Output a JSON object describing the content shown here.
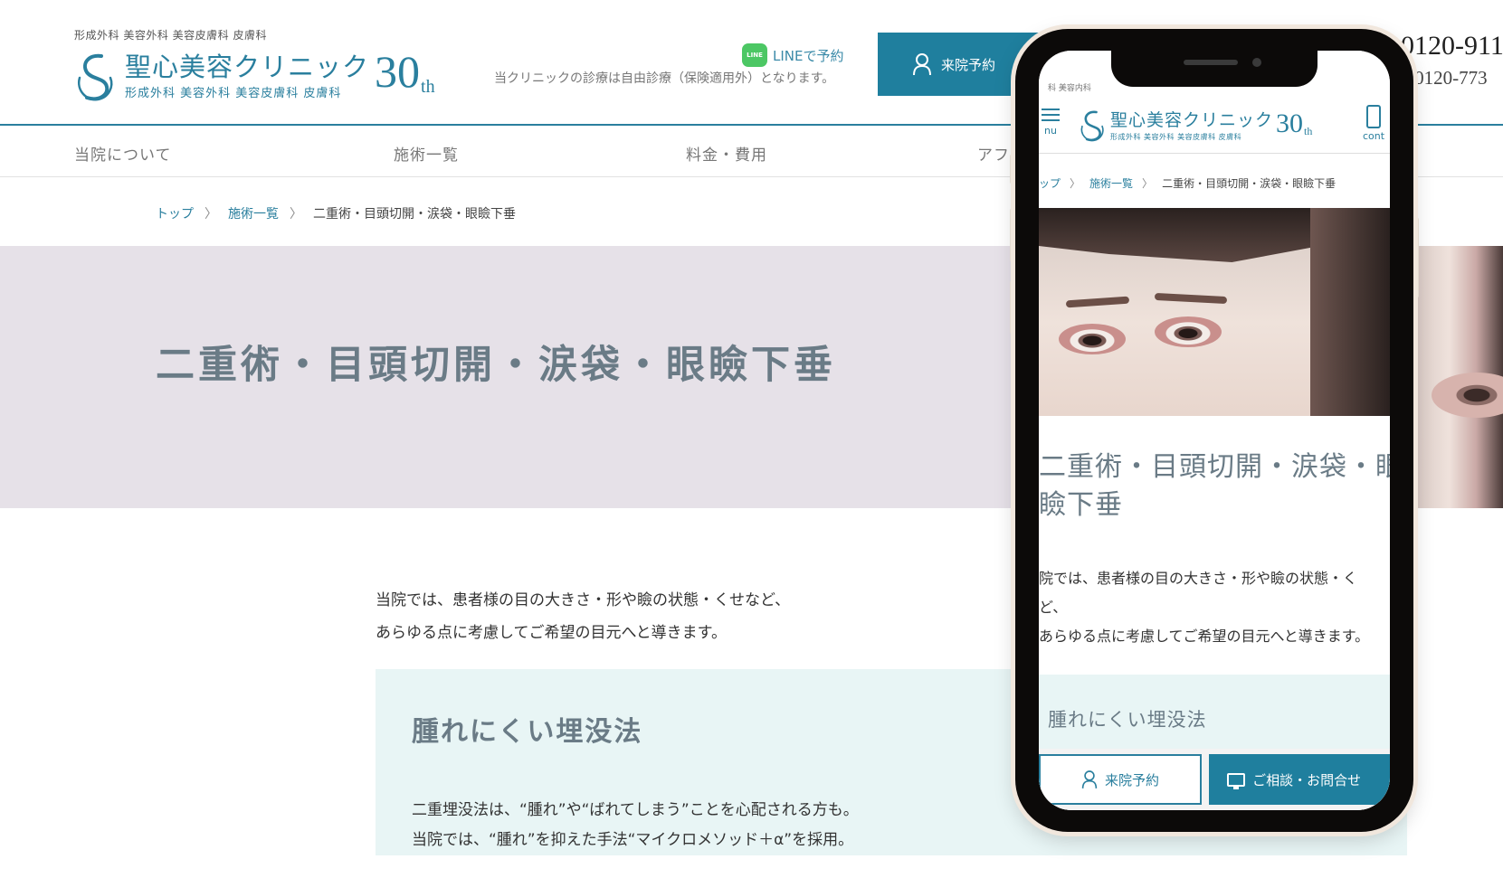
{
  "header": {
    "departments": "形成外科 美容外科 美容皮膚科 皮膚科",
    "logo_name": "聖心美容クリニック",
    "logo_sub": "形成外科 美容外科 美容皮膚科 皮膚科",
    "logo_anniversary": "30",
    "logo_anniversary_suffix": "th",
    "line_badge": "LINE",
    "line_link": "LINEで予約",
    "insurance_note": "当クリニックの診療は自由診療（保険適用外）となります。",
    "reserve_button": "来院予約",
    "tel_main": "0120-911",
    "tel_sub": ": 0120-773"
  },
  "nav": {
    "items": [
      "当院について",
      "施術一覧",
      "料金・費用",
      "アフ"
    ]
  },
  "breadcrumb": {
    "home": "トップ",
    "separator": "〉",
    "list": "施術一覧",
    "current": "二重術・目頭切開・涙袋・眼瞼下垂"
  },
  "hero": {
    "title": "二重術・目頭切開・涙袋・眼瞼下垂"
  },
  "lead": {
    "line1": "当院では、患者様の目の大きさ・形や瞼の状態・くせなど、",
    "line2": "あらゆる点に考慮してご希望の目元へと導きます。"
  },
  "feature": {
    "title": "腫れにくい埋没法",
    "body1": "二重埋没法は、“腫れ”や“ばれてしまう”ことを心配される方も。",
    "body2": "当院では、“腫れ”を抑えた手法“マイクロメソッド＋α”を採用。"
  },
  "mobile": {
    "tags": "科 美容内科",
    "menu_label": "nu",
    "contact_label": "cont",
    "breadcrumb_home": "ップ",
    "breadcrumb_sep": "〉",
    "breadcrumb_list": "施術一覧",
    "breadcrumb_current": "二重術・目頭切開・涙袋・眼瞼下垂",
    "title_line1": "二重術・目頭切開・涙袋・眼",
    "title_line2": "瞼下垂",
    "lead_line1": "院では、患者様の目の大きさ・形や瞼の状態・く",
    "lead_line2": "ど、",
    "lead_line3": "あらゆる点に考慮してご希望の目元へと導きます。",
    "feature_title": "腫れにくい埋没法",
    "reserve_button": "来院予約",
    "consult_button": "ご相談・お問合せ"
  },
  "colors": {
    "brand": "#2a7f9e",
    "hero_bg": "#e6e1e8",
    "feature_bg": "#e8f5f5",
    "title_text": "#6a7b86",
    "line_green": "#4cc764"
  },
  "icons": [
    "logo-swirl-icon",
    "line-icon",
    "person-icon",
    "menu-icon",
    "smartphone-icon",
    "monitor-icon"
  ]
}
